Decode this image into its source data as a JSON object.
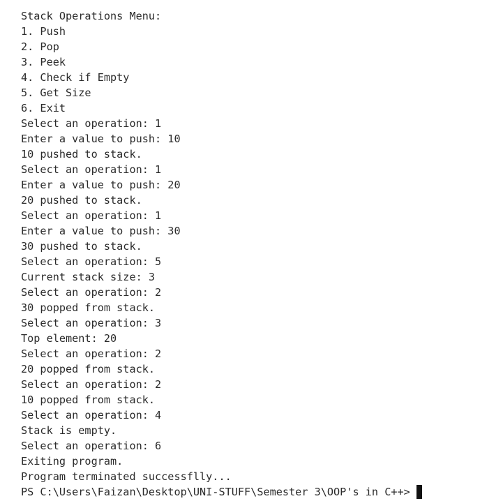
{
  "terminal": {
    "lines": [
      "Stack Operations Menu:",
      "1. Push",
      "2. Pop",
      "3. Peek",
      "4. Check if Empty",
      "5. Get Size",
      "6. Exit",
      "Select an operation: 1",
      "Enter a value to push: 10",
      "10 pushed to stack.",
      "Select an operation: 1",
      "Enter a value to push: 20",
      "20 pushed to stack.",
      "Select an operation: 1",
      "Enter a value to push: 30",
      "30 pushed to stack.",
      "Select an operation: 5",
      "Current stack size: 3",
      "Select an operation: 2",
      "30 popped from stack.",
      "Select an operation: 3",
      "Top element: 20",
      "Select an operation: 2",
      "20 popped from stack.",
      "Select an operation: 2",
      "10 popped from stack.",
      "Select an operation: 4",
      "Stack is empty.",
      "Select an operation: 6",
      "Exiting program.",
      "Program terminated successflly..."
    ],
    "prompt": "PS C:\\Users\\Faizan\\Desktop\\UNI-STUFF\\Semester 3\\OOP's in C++>"
  }
}
